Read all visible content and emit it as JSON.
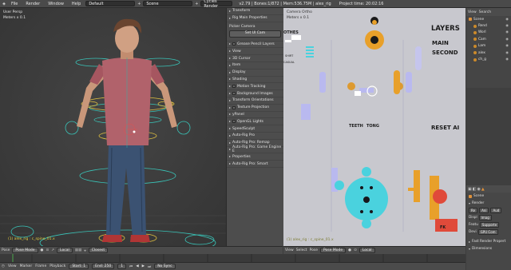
{
  "topbar": {
    "menus": [
      "File",
      "Render",
      "Window",
      "Help"
    ],
    "layout": "Default",
    "scene": "Scene",
    "engine": "Cycles Render",
    "stats": "v2.79 | Bones:1/872 | Mem:536.75M | alex_rig",
    "time": "Project time: 20:02:16"
  },
  "viewport": {
    "view_name": "User Persp",
    "units": "Meters x 0.1",
    "object_label": "(1) alex_rig : c_spine_01.x"
  },
  "npanel": {
    "rows": [
      "Transform",
      "Rig Main Properties"
    ],
    "picker_camera": "Picker Camera",
    "set_ui_cam": "Set UI Cam",
    "items": [
      "Grease Pencil Layers",
      "View",
      "3D Cursor",
      "Item",
      "Display",
      "Shading",
      "Motion Tracking",
      "Background Images",
      "Transform Orientations",
      "Texture Projection",
      "yPanel",
      "OpenGL Lights",
      "SpeedSculpt",
      "Auto-Rig Pro",
      "Auto-Rig Pro: Remap",
      "Auto-Rig Pro: Game Engine E",
      "Properties",
      "Auto-Rig Pro: Smart"
    ]
  },
  "picker": {
    "view_name": "Camera Ortho",
    "units": "Meters x 0.1",
    "labels": {
      "clothes": "OTHES",
      "shirt": "SHIRT",
      "casual": "CASUAL",
      "teeth": "TEETH",
      "tong": "TONG",
      "layers": "LAYERS",
      "main": "MAIN",
      "second": "SECOND",
      "reset": "RESET AI",
      "fk": "FK"
    },
    "object_label": "(1) alex_rig : c_spine_01.x"
  },
  "outliner": {
    "view": "View",
    "search": "Search",
    "items": [
      "Scene",
      "Rend",
      "Worl",
      "Cam",
      "Lam",
      "alex",
      "ch_g"
    ]
  },
  "properties": {
    "scene": "Scene",
    "render": "Render",
    "render_btns": [
      "Re",
      "Ani",
      "Aud"
    ],
    "display_label": "Displ",
    "display_value": "Imag",
    "feature_label": "Featu",
    "feature_value": "Supporte",
    "device_label": "Devi",
    "device_value": "GPU Com",
    "fast_render": "Fast Render Propert",
    "dimensions": "Dimensions"
  },
  "header_left": {
    "pose": "Pose",
    "mode": "Pose Mode",
    "pivot": "Local",
    "snap": "Closest"
  },
  "header_right": {
    "items": [
      "View",
      "Select",
      "Pose"
    ],
    "mode": "Pose Mode",
    "pivot": "Local"
  },
  "timeline": {
    "menus": [
      "View",
      "Marker",
      "Frame",
      "Playback"
    ],
    "start_label": "Start:",
    "start_value": "1",
    "end_label": "End:",
    "end_value": "250",
    "current": "1",
    "sync": "No Sync"
  }
}
